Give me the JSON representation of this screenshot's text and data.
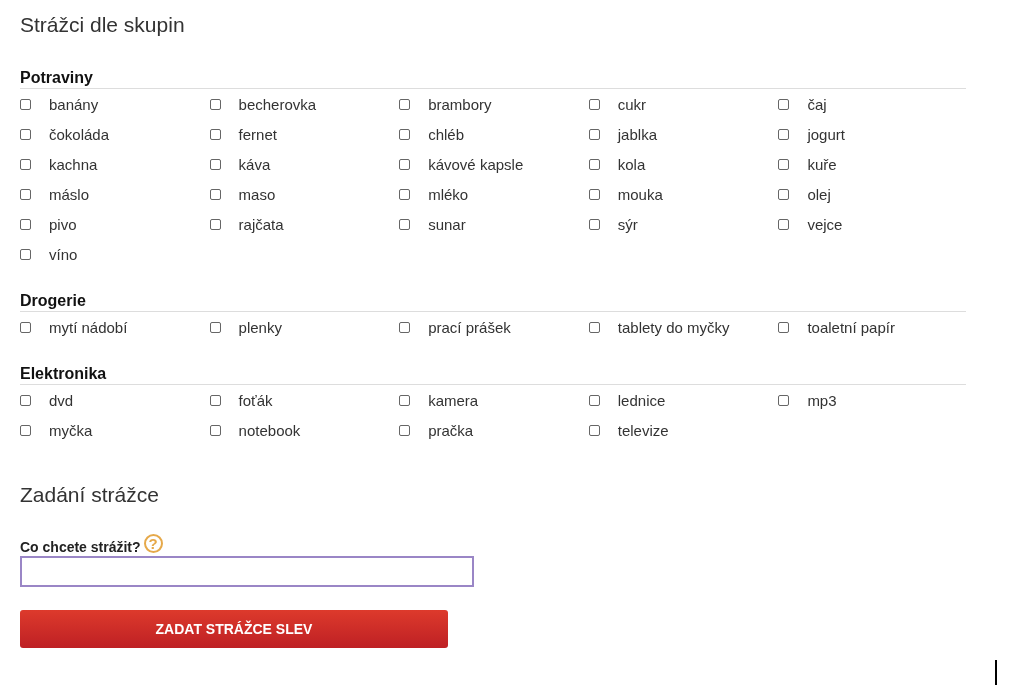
{
  "title": "Strážci dle skupin",
  "groups": [
    {
      "name": "Potraviny",
      "items": [
        {
          "label": "banány",
          "checked": false
        },
        {
          "label": "becherovka",
          "checked": false
        },
        {
          "label": "brambory",
          "checked": false
        },
        {
          "label": "cukr",
          "checked": false
        },
        {
          "label": "čaj",
          "checked": false
        },
        {
          "label": "čokoláda",
          "checked": false
        },
        {
          "label": "fernet",
          "checked": false
        },
        {
          "label": "chléb",
          "checked": false
        },
        {
          "label": "jablka",
          "checked": false
        },
        {
          "label": "jogurt",
          "checked": false
        },
        {
          "label": "kachna",
          "checked": false
        },
        {
          "label": "káva",
          "checked": false
        },
        {
          "label": "kávové kapsle",
          "checked": false
        },
        {
          "label": "kola",
          "checked": false
        },
        {
          "label": "kuře",
          "checked": false
        },
        {
          "label": "máslo",
          "checked": false
        },
        {
          "label": "maso",
          "checked": false
        },
        {
          "label": "mléko",
          "checked": false
        },
        {
          "label": "mouka",
          "checked": false
        },
        {
          "label": "olej",
          "checked": false
        },
        {
          "label": "pivo",
          "checked": false
        },
        {
          "label": "rajčata",
          "checked": false
        },
        {
          "label": "sunar",
          "checked": false
        },
        {
          "label": "sýr",
          "checked": false
        },
        {
          "label": "vejce",
          "checked": false
        },
        {
          "label": "víno",
          "checked": false
        }
      ]
    },
    {
      "name": "Drogerie",
      "items": [
        {
          "label": "mytí nádobí",
          "checked": false
        },
        {
          "label": "plenky",
          "checked": false
        },
        {
          "label": "prací prášek",
          "checked": false
        },
        {
          "label": "tablety do myčky",
          "checked": false
        },
        {
          "label": "toaletní papír",
          "checked": false
        }
      ]
    },
    {
      "name": "Elektronika",
      "items": [
        {
          "label": "dvd",
          "checked": false
        },
        {
          "label": "foťák",
          "checked": false
        },
        {
          "label": "kamera",
          "checked": false
        },
        {
          "label": "lednice",
          "checked": false
        },
        {
          "label": "mp3",
          "checked": false
        },
        {
          "label": "myčka",
          "checked": false
        },
        {
          "label": "notebook",
          "checked": false
        },
        {
          "label": "pračka",
          "checked": false
        },
        {
          "label": "televize",
          "checked": false
        }
      ]
    }
  ],
  "form": {
    "title": "Zadání strážce",
    "label": "Co chcete strážit?",
    "help": "?",
    "submit": "ZADAT STRÁŽCE SLEV"
  }
}
